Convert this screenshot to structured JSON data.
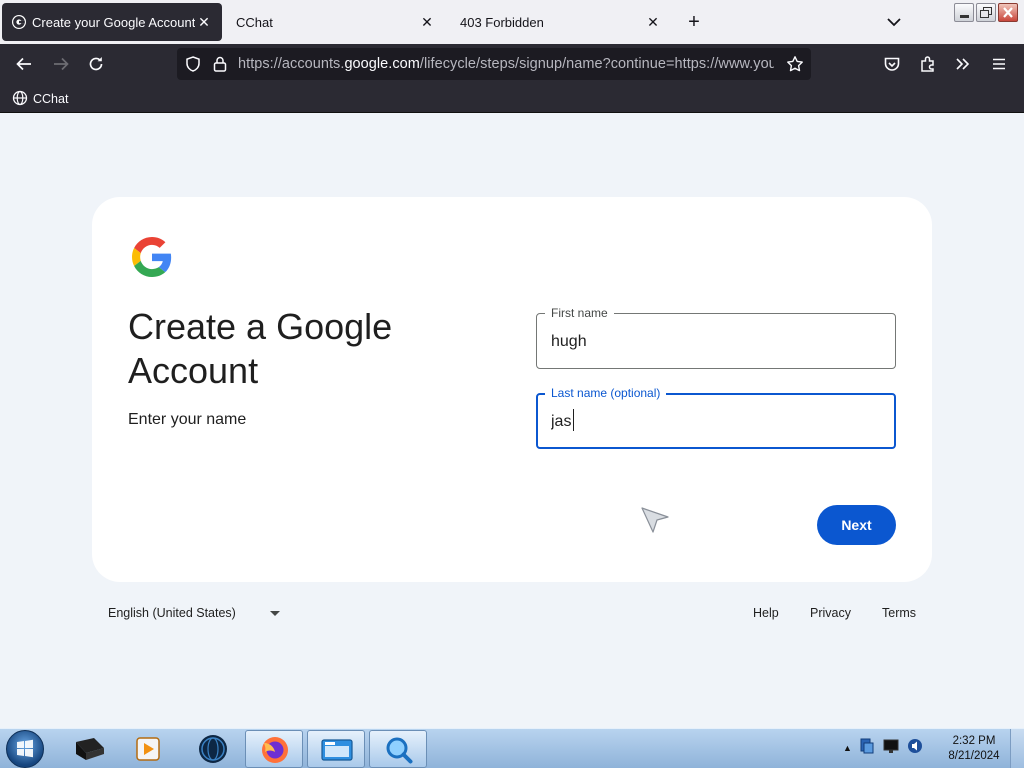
{
  "browser": {
    "tabs": [
      {
        "title": "Create your Google Account",
        "active": true
      },
      {
        "title": "CChat",
        "active": false
      },
      {
        "title": "403 Forbidden",
        "active": false
      }
    ],
    "url": {
      "scheme_prefix": "https://accounts.",
      "host": "google.com",
      "path": "/lifecycle/steps/signup/name?continue=https://www.youtube.com/signin"
    },
    "bookmarks": [
      {
        "label": "CChat"
      }
    ],
    "theme_colors": {
      "chrome_dark": "#2b2a33",
      "tabstrip": "#f0f0f4"
    }
  },
  "page": {
    "heading": "Create a Google Account",
    "subheading": "Enter your name",
    "first_name": {
      "label": "First name",
      "value": "hugh"
    },
    "last_name": {
      "label": "Last name (optional)",
      "value": "jas"
    },
    "next_label": "Next",
    "footer": {
      "language": "English (United States)",
      "links": [
        "Help",
        "Privacy",
        "Terms"
      ]
    },
    "accent_color": "#0b57d0"
  },
  "taskbar": {
    "apps": [
      "start-menu",
      "terminal",
      "media-player",
      "globe-app",
      "firefox",
      "window-app",
      "magnifier"
    ],
    "clock": {
      "time": "2:32 PM",
      "date": "8/21/2024"
    }
  }
}
